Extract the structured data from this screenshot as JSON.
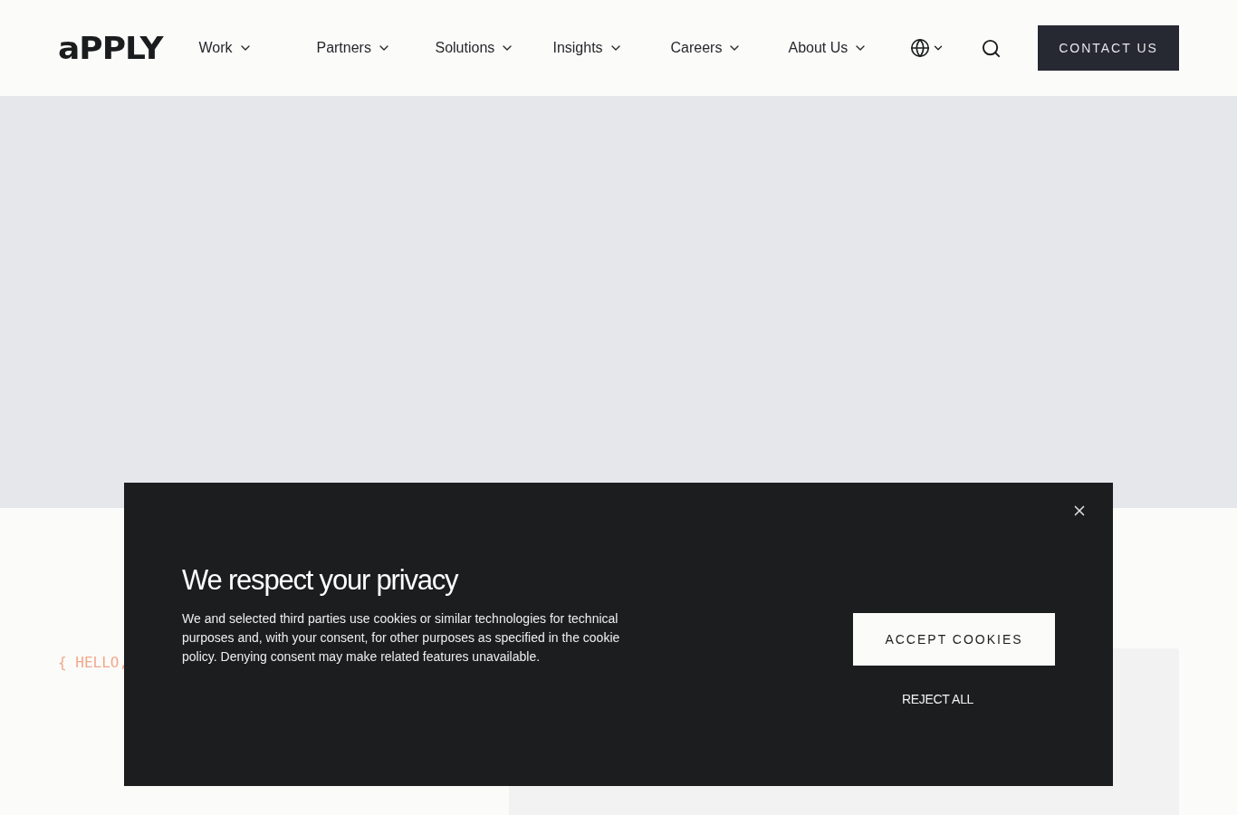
{
  "header": {
    "logo": "aPPLY",
    "nav": [
      {
        "label": "Work"
      },
      {
        "label": "Partners"
      },
      {
        "label": "Solutions"
      },
      {
        "label": "Insights"
      },
      {
        "label": "Careers"
      },
      {
        "label": "About Us"
      }
    ],
    "contact_button": "CONTACT US"
  },
  "intro": {
    "eyebrow": "{ HELLO,"
  },
  "cookie_banner": {
    "title": "We respect your privacy",
    "body": "We and selected third parties use cookies or similar technologies for technical purposes and, with your consent, for other purposes as specified in the cookie policy. Denying consent may make related features unavailable.",
    "accept": "ACCEPT COOKIES",
    "reject": "REJECT ALL"
  }
}
